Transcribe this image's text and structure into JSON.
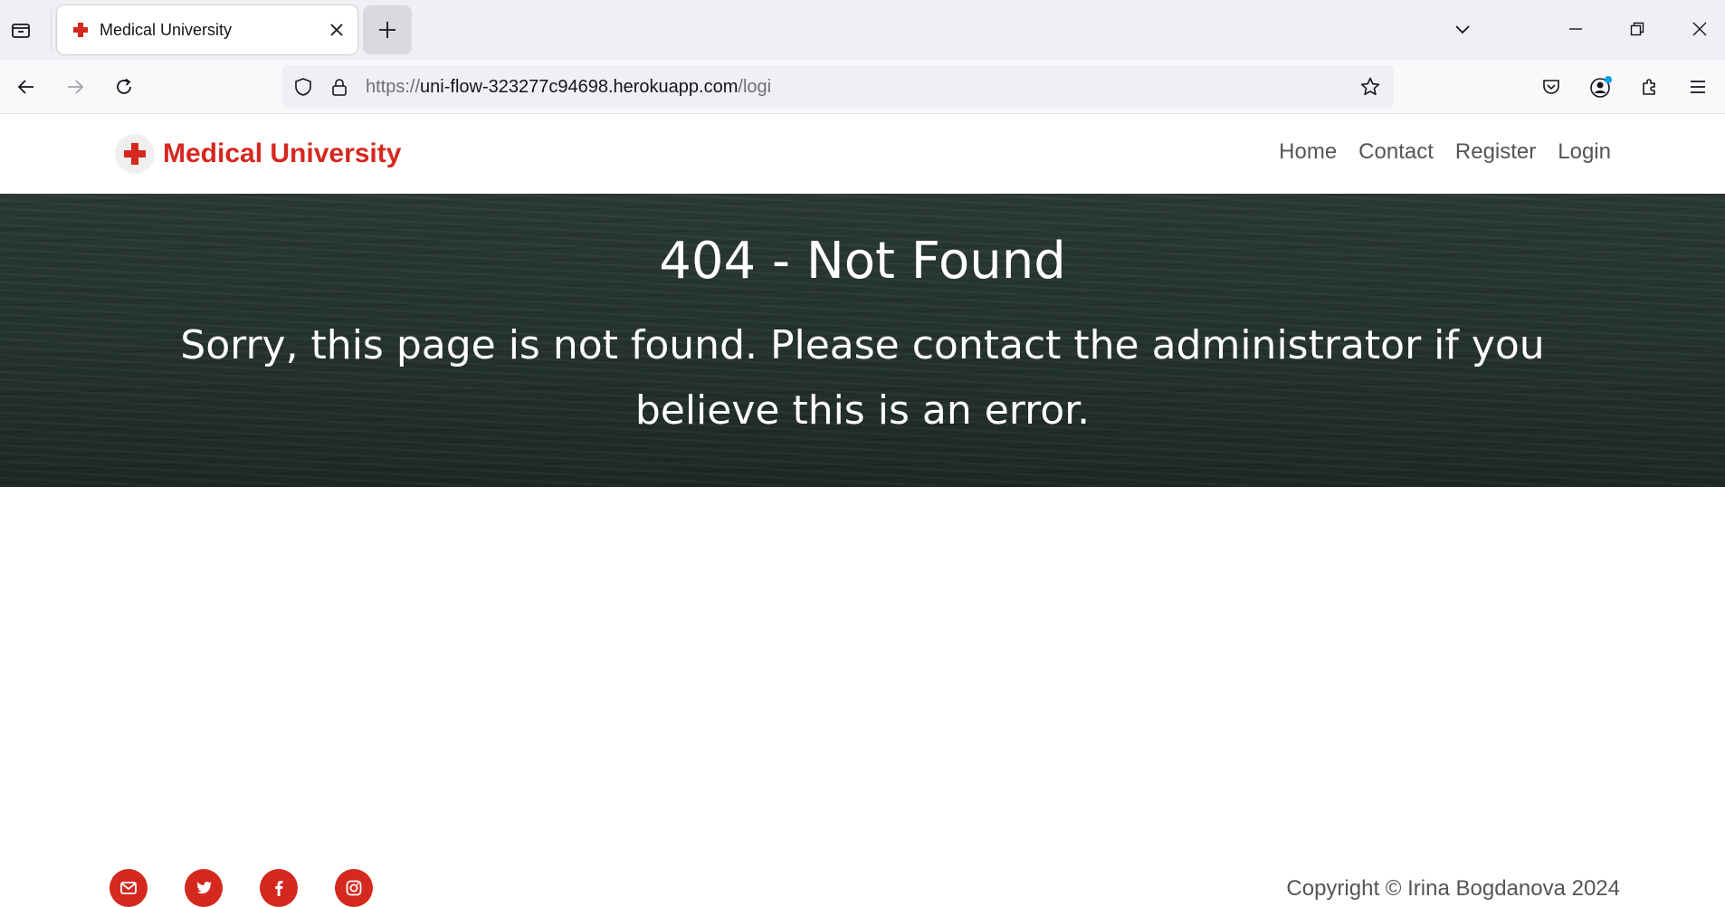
{
  "browser": {
    "tab_title": "Medical University",
    "url_prefix": "https://",
    "url_host": "uni-flow-323277c94698.herokuapp.com",
    "url_path": "/logi",
    "icons": [
      "list-all-tabs-icon",
      "favicon-red-cross",
      "close-tab-icon",
      "new-tab-icon",
      "tab-overflow-chevron-icon",
      "minimize-icon",
      "restore-icon",
      "close-window-icon",
      "back-arrow-icon",
      "forward-arrow-icon",
      "reload-icon",
      "tracking-shield-icon",
      "lock-icon",
      "bookmark-star-icon",
      "pocket-icon",
      "account-icon",
      "extensions-icon",
      "app-menu-icon"
    ]
  },
  "site": {
    "brand": "Medical University",
    "nav": [
      "Home",
      "Contact",
      "Register",
      "Login"
    ],
    "brand_color": "#d5281f"
  },
  "hero": {
    "heading": "404 - Not Found",
    "message": "Sorry, this page is not found. Please contact the administrator if you believe this is an error."
  },
  "footer": {
    "social_icons": [
      "email-icon",
      "twitter-icon",
      "facebook-icon",
      "instagram-icon"
    ],
    "copyright": "Copyright © Irina Bogdanova 2024"
  }
}
